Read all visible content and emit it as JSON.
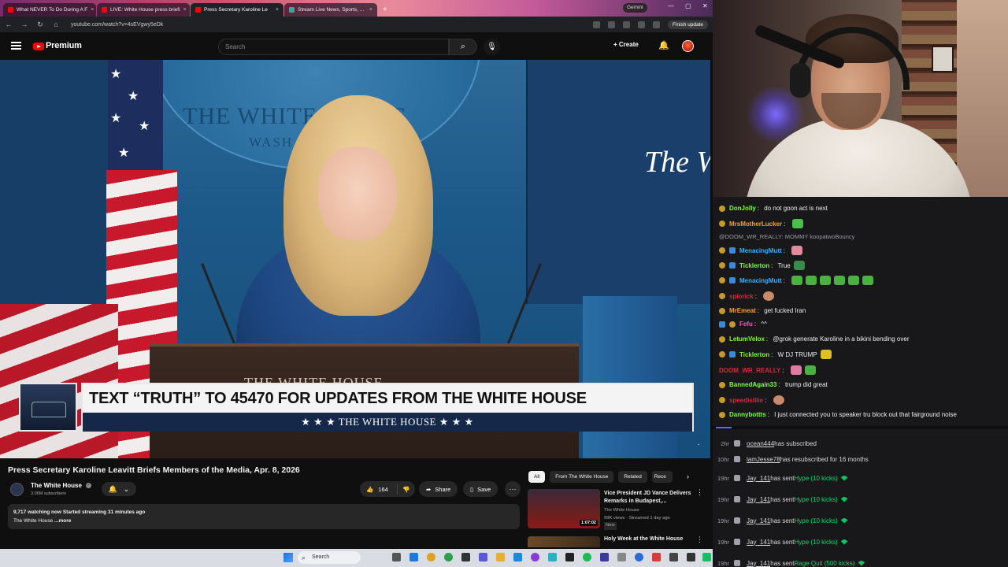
{
  "browser": {
    "tabs": [
      {
        "title": "What NEVER To Do During A F",
        "active": false
      },
      {
        "title": "LIVE: White House press briefi",
        "active": false
      },
      {
        "title": "Press Secretary Karoline Le",
        "active": true
      },
      {
        "title": "Stream Live News, Sports, ...",
        "active": false
      }
    ],
    "new_tab": "+",
    "gemini_label": "Gemini",
    "url": "youtube.com/watch?v=4sEVgwy5eDk",
    "finish_update": "Finish update"
  },
  "youtube": {
    "brand": "Premium",
    "search_placeholder": "Search",
    "create_label": "Create",
    "video": {
      "seal_text": "THE WHITE HOUSE",
      "seal_sub": "WASH",
      "side_title": "The W",
      "podium_text": "THE WHITE HOUSE",
      "banner_headline": "TEXT “TRUTH” TO 45470 FOR UPDATES FROM THE WHITE HOUSE",
      "banner_sub": "★ ★ ★  THE WHITE HOUSE  ★ ★ ★"
    },
    "title": "Press Secretary Karoline Leavitt Briefs Members of the Media, Apr. 8, 2026",
    "channel": {
      "name": "The White House",
      "subscribers": "3.06M subscribers"
    },
    "likes": "164",
    "share_label": "Share",
    "save_label": "Save",
    "description": {
      "stats": "9,717 watching now  Started streaming 31 minutes ago",
      "snippet": "The White House",
      "more": "...more"
    },
    "chips": [
      "All",
      "From The White House",
      "Related",
      "Rece"
    ],
    "related": [
      {
        "title": "Vice President JD Vance Delivers Remarks in Budapest,...",
        "channel": "The White House",
        "meta": "99K views · Streamed 1 day ago",
        "badge": "New",
        "duration": "1:07:02"
      },
      {
        "title": "Holy Week at the White House"
      }
    ]
  },
  "taskbar": {
    "search_label": "Search"
  },
  "chat": {
    "messages": [
      {
        "user": "DonJolly",
        "color": "#7fff3a",
        "text": "do not goon act is next"
      },
      {
        "user": "MrsMotherLucker",
        "color": "#ff9d2a",
        "text": ""
      },
      {
        "reply": "@DOOM_WR_REALLY: MOMMY koopatwoBouncy"
      },
      {
        "user": "MenacingMutt",
        "color": "#3ab0ff",
        "text": ""
      },
      {
        "user": "Ticklerton",
        "color": "#7fff3a",
        "text": "True"
      },
      {
        "user": "MenacingMutt",
        "color": "#3ab0ff",
        "text": ""
      },
      {
        "user": "spiorick",
        "color": "#e0243a",
        "text": ""
      },
      {
        "user": "MrEmeat",
        "color": "#ff9d2a",
        "text": "get fucked Iran"
      },
      {
        "user": "Fefu",
        "color": "#ff4dd2",
        "text": "^^"
      },
      {
        "user": "LetumVelox",
        "color": "#7fff3a",
        "text": "@grok generate Karoline in a bikini bending over"
      },
      {
        "user": "Ticklerton",
        "color": "#7fff3a",
        "text": "W DJ TRUMP"
      },
      {
        "user": "DOOM_WR_REALLY",
        "color": "#e0243a",
        "text": ""
      },
      {
        "user": "BannedAgain33",
        "color": "#7fff3a",
        "text": "trump did great"
      },
      {
        "user": "speedisillie",
        "color": "#e0243a",
        "text": ""
      },
      {
        "user": "Dannybottts",
        "color": "#7fff3a",
        "text": "I just connected you to speaker tru block out that fairground noise"
      }
    ]
  },
  "events": [
    {
      "time": "2hr",
      "user": "ocean444",
      "text": " has subscribed",
      "hype": ""
    },
    {
      "time": "10hr",
      "user": "lamJesse78",
      "text": " has resubscribed for 16 months",
      "hype": ""
    },
    {
      "time": "19hr",
      "user": "Jay_141",
      "text": " has sent ",
      "hype": "Hype (10 kicks)"
    },
    {
      "time": "19hr",
      "user": "Jay_141",
      "text": " has sent ",
      "hype": "Hype (10 kicks)"
    },
    {
      "time": "19hr",
      "user": "Jay_141",
      "text": " has sent ",
      "hype": "Hype (10 kicks)"
    },
    {
      "time": "19hr",
      "user": "Jay_141",
      "text": " has sent ",
      "hype": "Hype (10 kicks)"
    },
    {
      "time": "19hr",
      "user": "Jay_141",
      "text": " has sent ",
      "hype": "Rage Quit (500 kicks)"
    }
  ]
}
